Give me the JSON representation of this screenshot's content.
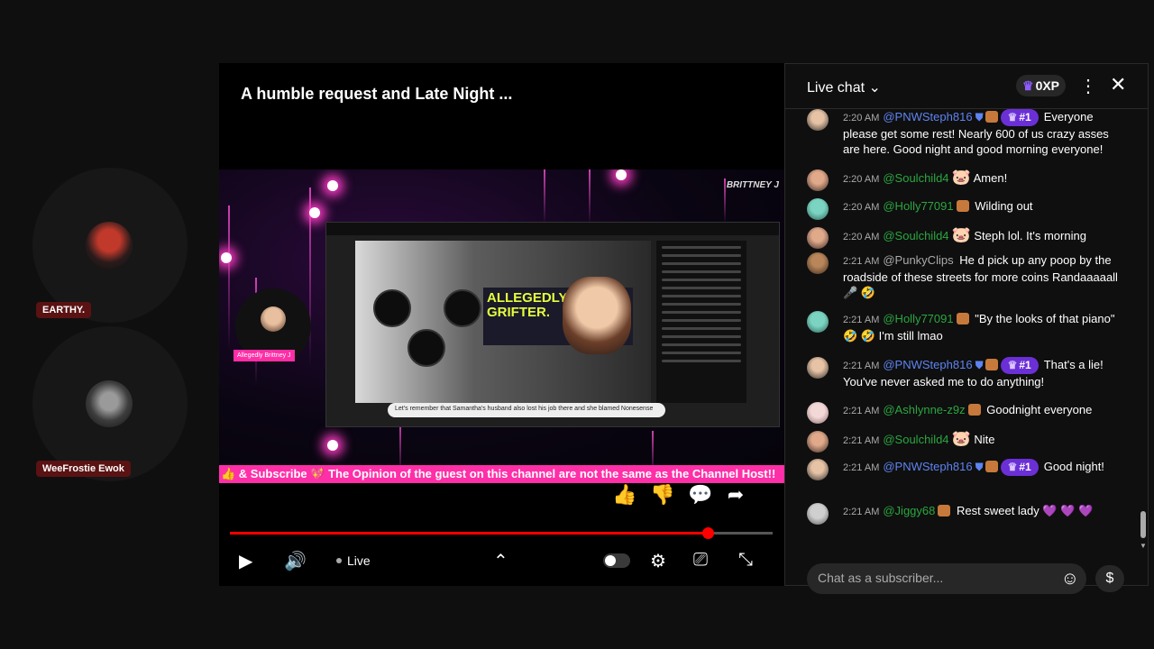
{
  "participants": [
    {
      "name": "EARTHY."
    },
    {
      "name": "WeeFrostie Ewok"
    }
  ],
  "player": {
    "title": "A humble request and Late Night ...",
    "overlay_brand": "BRITTNEY J",
    "inner_overlay_text": "ALLEGEDLY A GRIFTER.",
    "inner_caption": "Let's remember that Samantha's husband also lost his job there and she blamed Nonesense",
    "guest_label": "Allegedly Brittney J",
    "ticker": "👍 & Subscribe 💖 The Opinion of the guest on this channel are not the same as the Channel Host!!",
    "live_label": "Live",
    "progress_fraction": 0.88,
    "accent_color": "#ff0000"
  },
  "chat": {
    "title": "Live chat",
    "xp": "0XP",
    "input_placeholder": "Chat as a subscriber...",
    "messages": [
      {
        "time": "2:20 AM",
        "user": "@PNWSteph816",
        "rank": "#1",
        "text": "Everyone please get some rest! Nearly 600 of us crazy asses are here. Good night and good morning everyone!"
      },
      {
        "time": "2:20 AM",
        "user": "@Soulchild4",
        "text": "Amen!"
      },
      {
        "time": "2:20 AM",
        "user": "@Holly77091",
        "text": "Wilding out"
      },
      {
        "time": "2:20 AM",
        "user": "@Soulchild4",
        "text": "Steph lol. It's morning"
      },
      {
        "time": "2:21 AM",
        "user": "@PunkyClips",
        "text": "He d pick up any poop by the roadside of these streets for more coins Randaaaaall 🎤 🤣"
      },
      {
        "time": "2:21 AM",
        "user": "@Holly77091",
        "text": "\"By the looks of that piano\" 🤣 🤣 I'm still lmao"
      },
      {
        "time": "2:21 AM",
        "user": "@PNWSteph816",
        "rank": "#1",
        "text": "That's a lie! You've never asked me to do anything!"
      },
      {
        "time": "2:21 AM",
        "user": "@Ashlynne-z9z",
        "text": "Goodnight everyone"
      },
      {
        "time": "2:21 AM",
        "user": "@Soulchild4",
        "text": "Nite"
      },
      {
        "time": "2:21 AM",
        "user": "@PNWSteph816",
        "rank": "#1",
        "text": "Good night!"
      },
      {
        "time": "2:21 AM",
        "user": "@Jiggy68",
        "text": "Rest sweet lady 💜 💜 💜"
      }
    ]
  }
}
